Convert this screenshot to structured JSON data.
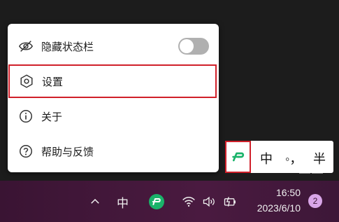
{
  "menu": {
    "items": [
      {
        "label": "隐藏状态栏",
        "icon": "eye-off-icon"
      },
      {
        "label": "设置",
        "icon": "hexagon-settings-icon"
      },
      {
        "label": "关于",
        "icon": "info-icon"
      },
      {
        "label": "帮助与反馈",
        "icon": "question-icon"
      }
    ],
    "toggle_state": "off"
  },
  "ime_bar": {
    "logo": "ime-logo-icon",
    "mode": "中",
    "punctuation": "◦，",
    "width_mode": "半"
  },
  "taskbar": {
    "language": "中",
    "time": "16:50",
    "date": "2023/6/10",
    "notification_count": "2"
  },
  "colors": {
    "highlight": "#d0202a",
    "taskbar": "#3a1433",
    "logo_green": "#1ab36a",
    "badge": "#d9a6e8"
  }
}
